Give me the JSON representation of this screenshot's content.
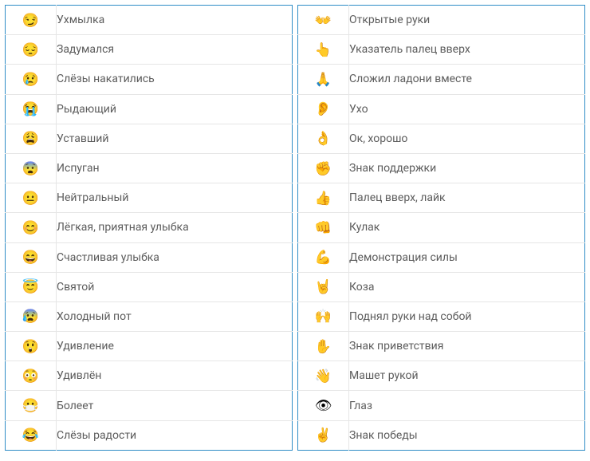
{
  "left": [
    {
      "emoji": "😏",
      "label": "Ухмылка"
    },
    {
      "emoji": "😔",
      "label": "Задумался"
    },
    {
      "emoji": "😢",
      "label": "Слёзы накатились"
    },
    {
      "emoji": "😭",
      "label": "Рыдающий"
    },
    {
      "emoji": "😩",
      "label": "Уставший"
    },
    {
      "emoji": "😨",
      "label": "Испуган"
    },
    {
      "emoji": "😐",
      "label": "Нейтральный"
    },
    {
      "emoji": "😊",
      "label": "Лёгкая, приятная улыбка"
    },
    {
      "emoji": "😄",
      "label": "Счастливая улыбка"
    },
    {
      "emoji": "😇",
      "label": "Святой"
    },
    {
      "emoji": "😰",
      "label": "Холодный пот"
    },
    {
      "emoji": "😲",
      "label": "Удивление"
    },
    {
      "emoji": "😳",
      "label": "Удивлён"
    },
    {
      "emoji": "😷",
      "label": "Болеет"
    },
    {
      "emoji": "😂",
      "label": "Слёзы радости"
    }
  ],
  "right": [
    {
      "emoji": "👐",
      "label": "Открытые руки"
    },
    {
      "emoji": "👆",
      "label": "Указатель палец вверх"
    },
    {
      "emoji": "🙏",
      "label": "Сложил ладони вместе"
    },
    {
      "emoji": "👂",
      "label": "Ухо"
    },
    {
      "emoji": "👌",
      "label": "Ок, хорошо"
    },
    {
      "emoji": "✊",
      "label": "Знак поддержки"
    },
    {
      "emoji": "👍",
      "label": "Палец вверх, лайк"
    },
    {
      "emoji": "👊",
      "label": "Кулак"
    },
    {
      "emoji": "💪",
      "label": "Демонстрация силы"
    },
    {
      "emoji": "🤘",
      "label": "Коза"
    },
    {
      "emoji": "🙌",
      "label": "Поднял руки над собой"
    },
    {
      "emoji": "✋",
      "label": "Знак приветствия"
    },
    {
      "emoji": "👋",
      "label": "Машет рукой"
    },
    {
      "emoji": "👁",
      "label": "Глаз"
    },
    {
      "emoji": "✌",
      "label": "Знак победы"
    }
  ]
}
